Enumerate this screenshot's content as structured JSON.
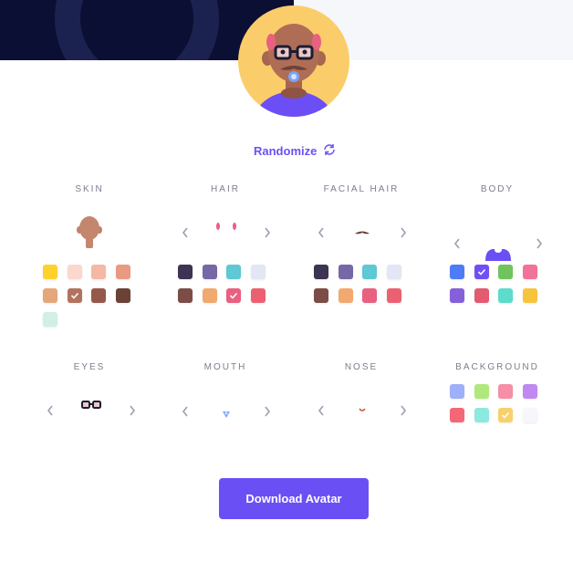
{
  "randomize": {
    "label": "Randomize",
    "icon": "refresh-icon"
  },
  "download": {
    "label": "Download Avatar"
  },
  "sections": {
    "skin": {
      "label": "SKIN"
    },
    "hair": {
      "label": "HAIR"
    },
    "facial_hair": {
      "label": "FACIAL HAIR"
    },
    "body": {
      "label": "BODY"
    },
    "eyes": {
      "label": "EYES"
    },
    "mouth": {
      "label": "MOUTH"
    },
    "nose": {
      "label": "NOSE"
    },
    "background": {
      "label": "BACKGROUND"
    }
  },
  "swatches": {
    "skin": [
      "#fed12d",
      "#fbd7cd",
      "#f4b8a4",
      "#e99a82",
      "#e4a77c",
      "#b2735c",
      "#95594a",
      "#6b4236",
      "#d2efe3"
    ],
    "skin_selected": 5,
    "hair": [
      "#3d3352",
      "#7668a7",
      "#5ec8d4",
      "#e2e6f5",
      "#7c4d47",
      "#f2a970",
      "#e96081",
      "#eb6171"
    ],
    "hair_selected": 6,
    "facial_hair": [
      "#3d3352",
      "#7668a7",
      "#5ec8d4",
      "#e2e6f5",
      "#7c4d47",
      "#f2a970",
      "#e96081",
      "#eb6171"
    ],
    "facial_hair_selected": -1,
    "body": [
      "#4d7cf7",
      "#7050f5",
      "#70c35d",
      "#f2739a",
      "#8460da",
      "#e45a6e",
      "#5ddbcb",
      "#f8c43e"
    ],
    "body_selected": 1,
    "background": [
      "#9eb0f8",
      "#b0e87c",
      "#f58ea6",
      "#c089f1",
      "#f46777",
      "#8de8e0",
      "#f8d06c",
      "#f6f7fb"
    ],
    "background_selected": 6
  },
  "colors": {
    "accent": "#6a4ff5",
    "check": "#ffffff"
  }
}
